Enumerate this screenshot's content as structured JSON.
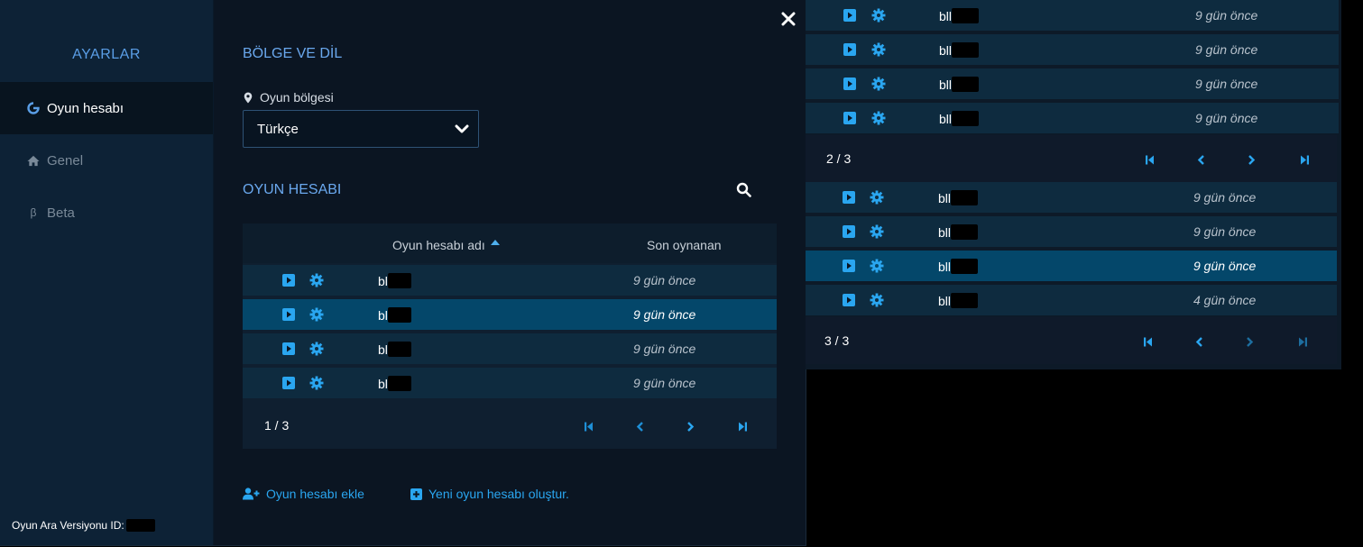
{
  "sidebar": {
    "title": "AYARLAR",
    "items": [
      {
        "label": "Oyun hesabı",
        "active": true
      },
      {
        "label": "Genel",
        "active": false
      },
      {
        "label": "Beta",
        "active": false
      }
    ],
    "version_label": "Oyun Ara Versiyonu ID:"
  },
  "region": {
    "heading": "BÖLGE VE DİL",
    "label": "Oyun bölgesi",
    "selected": "Türkçe"
  },
  "accounts": {
    "heading": "OYUN HESABI",
    "columns": {
      "name": "Oyun hesabı adı",
      "last_played": "Son oynanan"
    },
    "rows": [
      {
        "name": "bl",
        "last": "9 gün önce",
        "selected": false
      },
      {
        "name": "bl",
        "last": "9 gün önce",
        "selected": true
      },
      {
        "name": "bl",
        "last": "9 gün önce",
        "selected": false
      },
      {
        "name": "bl",
        "last": "9 gün önce",
        "selected": false
      }
    ],
    "page": "1 / 3",
    "add_label": "Oyun hesabı ekle",
    "create_label": "Yeni oyun hesabı oluştur."
  },
  "page2": {
    "rows": [
      {
        "name": "bll",
        "last": "9 gün önce",
        "selected": false
      },
      {
        "name": "bll",
        "last": "9 gün önce",
        "selected": false
      },
      {
        "name": "bll",
        "last": "9 gün önce",
        "selected": false
      },
      {
        "name": "bll",
        "last": "9 gün önce",
        "selected": false
      }
    ],
    "page": "2 / 3"
  },
  "page3": {
    "rows": [
      {
        "name": "bll",
        "last": "9 gün önce",
        "selected": false
      },
      {
        "name": "bll",
        "last": "9 gün önce",
        "selected": false
      },
      {
        "name": "bll",
        "last": "9 gün önce",
        "selected": true
      },
      {
        "name": "bll",
        "last": "4 gün önce",
        "selected": false
      }
    ],
    "page": "3 / 3"
  },
  "colors": {
    "accent": "#2aa6f0",
    "heading": "#6aa8ee",
    "selected_row": "#04476a",
    "row": "#0e2b3f"
  }
}
